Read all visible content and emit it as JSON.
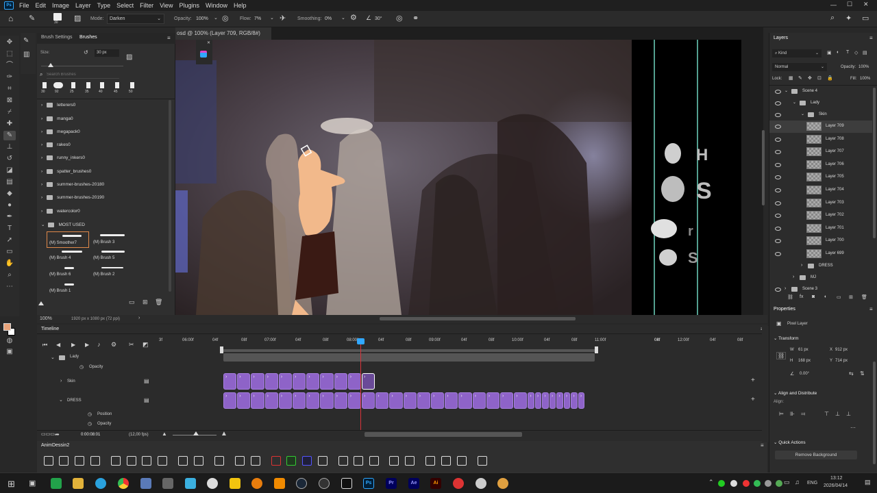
{
  "menu": [
    "File",
    "Edit",
    "Image",
    "Layer",
    "Type",
    "Select",
    "Filter",
    "View",
    "Plugins",
    "Window",
    "Help"
  ],
  "options": {
    "brush_size": "30",
    "mode_label": "Mode:",
    "mode_value": "Darken",
    "opacity_label": "Opacity:",
    "opacity_value": "100%",
    "flow_label": "Flow:",
    "flow_value": "7%",
    "smoothing_label": "Smoothing:",
    "smoothing_value": "0%",
    "angle_value": "30°"
  },
  "brush_panel": {
    "tabs": [
      "Brush Settings",
      "Brushes"
    ],
    "size_label": "Size:",
    "size_value": "30 px",
    "search_placeholder": "Search Brushes",
    "preset_sizes": [
      "30",
      "92",
      "25",
      "35",
      "40",
      "45",
      "50"
    ],
    "folders": [
      "letterers0",
      "manga0",
      "megapack0",
      "rakes0",
      "runny_inkers0",
      "spatter_brushes0",
      "summer-brushes-20180",
      "summer-brushes-20190",
      "watercolor0",
      "MOST USED"
    ],
    "most_used": [
      "(M) Smoother7",
      "(M) Brush 3",
      "(M) Brush 4",
      "(M) Brush 5",
      "(M) Brush 6",
      "(M) Brush 2",
      "(M) Brush 1"
    ]
  },
  "document": {
    "tab": "osd @ 100% (Layer 709, RGB/8#) *",
    "zoom": "100%",
    "info": "1920 px x 1080 px (72 ppi)"
  },
  "layers": {
    "title": "Layers",
    "kind": "Kind",
    "blend": "Normal",
    "opacity_label": "Opacity:",
    "opacity_value": "100%",
    "lock_label": "Lock:",
    "fill_label": "Fill:",
    "fill_value": "100%",
    "groups": [
      "Scene 4",
      "Lady",
      "Skin"
    ],
    "items": [
      "Layer 709",
      "Layer 708",
      "Layer 707",
      "Layer 706",
      "Layer 705",
      "Layer 704",
      "Layer 703",
      "Layer 702",
      "Layer 701",
      "Layer 700",
      "Layer 699"
    ],
    "after": [
      "DRESS",
      "MJ",
      "Scene 3"
    ]
  },
  "properties": {
    "title": "Properties",
    "kind": "Pixel Layer",
    "transform": "Transform",
    "w_label": "W",
    "w": "61 px",
    "h_label": "H",
    "h": "168 px",
    "x_label": "X",
    "x": "912 px",
    "y_label": "Y",
    "y": "714 px",
    "angle": "0.00°",
    "align": "Align and Distribute",
    "align_label": "Align:",
    "quick": "Quick Actions",
    "remove_bg": "Remove Background"
  },
  "timeline": {
    "title": "Timeline",
    "ticks": [
      "3f",
      "06:00f",
      "04f",
      "08f",
      "07:00f",
      "04f",
      "08f",
      "08:00f",
      "04f",
      "08f",
      "09:00f",
      "04f",
      "08f",
      "10:00f",
      "04f",
      "08f",
      "11:00f",
      "04f",
      "08f",
      "12:00f",
      "04f",
      "08f"
    ],
    "tracks": [
      "Lady",
      "Opacity",
      "Skin",
      "DRESS",
      "Position",
      "Opacity"
    ],
    "time": "0:00:08:01",
    "fps": "(12,00 fps)"
  },
  "anim_panel": {
    "title": "AnimDessin2"
  },
  "taskbar": {
    "lang": "ENG",
    "time": "13:12",
    "date": "2026/04/14"
  },
  "colors": {
    "accent": "#31a8ff",
    "clip": "#8e63c8",
    "playhead": "#d9343a",
    "foreground": "#e8a37a"
  }
}
